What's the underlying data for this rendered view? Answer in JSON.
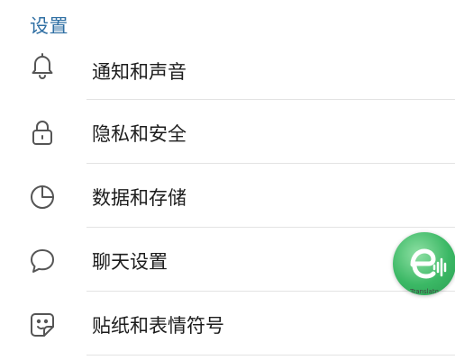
{
  "header": {
    "title": "设置"
  },
  "settings": {
    "items": [
      {
        "label": "通知和声音",
        "icon": "bell-icon"
      },
      {
        "label": "隐私和安全",
        "icon": "lock-icon"
      },
      {
        "label": "数据和存储",
        "icon": "pie-chart-icon"
      },
      {
        "label": "聊天设置",
        "icon": "chat-bubble-icon"
      },
      {
        "label": "贴纸和表情符号",
        "icon": "sticker-icon"
      }
    ]
  },
  "overlay": {
    "translator_label": "Translato",
    "accent": "#3bb865"
  },
  "colors": {
    "title": "#2f6fa3",
    "text": "#1c1c1c",
    "icon": "#555555",
    "divider": "#e3e3e3"
  }
}
